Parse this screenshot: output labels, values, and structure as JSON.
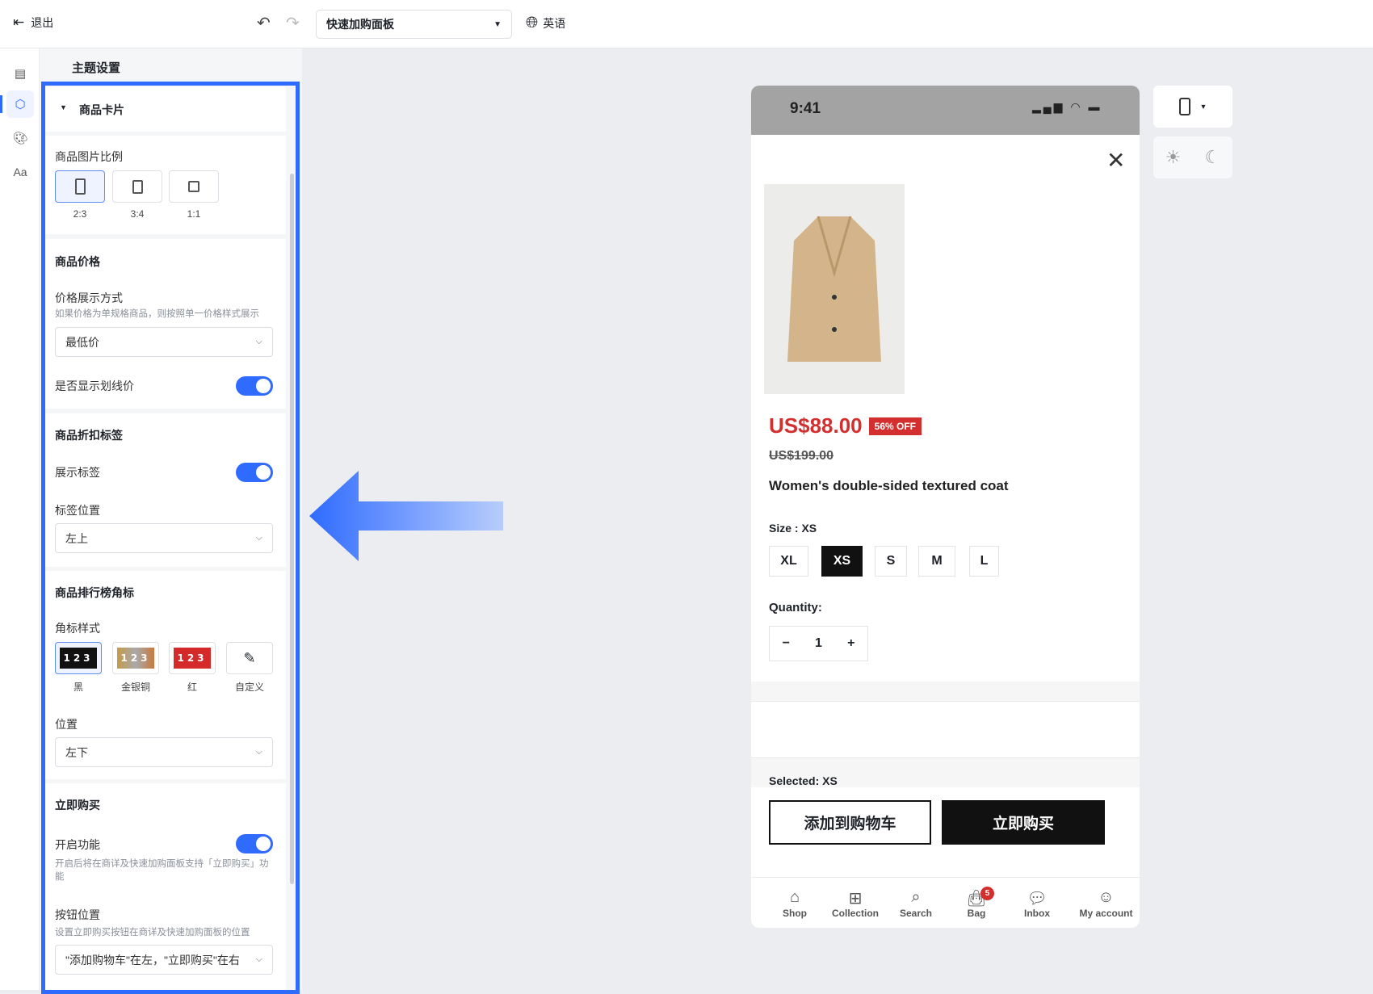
{
  "topbar": {
    "exit_label": "退出",
    "page_select": "快速加购面板",
    "language": "英语"
  },
  "panel": {
    "title": "主题设置",
    "card_section": "商品卡片",
    "image_ratio": {
      "label": "商品图片比例",
      "options": [
        "2:3",
        "3:4",
        "1:1"
      ],
      "selected": "2:3"
    },
    "price": {
      "heading": "商品价格",
      "display_label": "价格展示方式",
      "display_hint": "如果价格为单规格商品，则按照单一价格样式展示",
      "display_value": "最低价",
      "strike_label": "是否显示划线价",
      "strike_on": true
    },
    "discount": {
      "heading": "商品折扣标签",
      "show_label": "展示标签",
      "show_on": true,
      "position_label": "标签位置",
      "position_value": "左上"
    },
    "rank": {
      "heading": "商品排行榜角标",
      "style_label": "角标样式",
      "styles": [
        "黑",
        "金银铜",
        "红",
        "自定义"
      ],
      "selected": "黑",
      "position_label": "位置",
      "position_value": "左下"
    },
    "buy_now": {
      "heading": "立即购买",
      "enable_label": "开启功能",
      "enable_on": true,
      "enable_hint": "开启后将在商详及快速加购面板支持「立即购买」功能",
      "button_pos_label": "按钮位置",
      "button_pos_hint": "设置立即购买按钮在商详及快速加购面板的位置",
      "button_pos_value": "\"添加购物车\"在左，\"立即购买\"在右"
    }
  },
  "phone": {
    "time": "9:41",
    "price": "US$88.00",
    "discount_badge": "56% OFF",
    "original_price": "US$199.00",
    "product_name": "Women's double-sided textured coat",
    "size_label": "Size : XS",
    "sizes": [
      "XL",
      "XS",
      "S",
      "M",
      "L"
    ],
    "selected_size": "XS",
    "quantity_label": "Quantity:",
    "quantity": "1",
    "selected_label": "Selected: XS",
    "add_to_cart": "添加到购物车",
    "buy_now": "立即购买",
    "nav": [
      "Shop",
      "Collection",
      "Search",
      "Bag",
      "Inbox",
      "My account"
    ],
    "bag_count": "5"
  },
  "colors": {
    "accent": "#2f6bff",
    "price_red": "#d32f2f"
  }
}
